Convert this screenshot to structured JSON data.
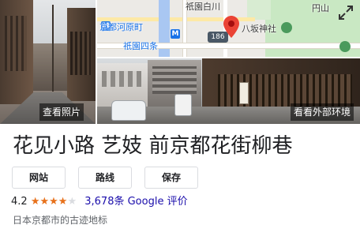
{
  "place": {
    "title": "花见小路 艺妓 前京都花街柳巷",
    "description": "日本京都市的古迹地标"
  },
  "photos": {
    "view_photos_label": "查看照片",
    "view_outside_label": "看看外部环境"
  },
  "map": {
    "labels": {
      "gion_shirakawa": "祇園白川",
      "maruyama": "円山",
      "kyoto_kawaramachi": "京都河原町",
      "yasaka_shrine": "八坂神社",
      "gion_shijo": "祇園四条",
      "route_number": "186"
    },
    "metro_glyph": "M",
    "expand_icon": "expand-icon"
  },
  "actions": {
    "website_label": "网站",
    "directions_label": "路线",
    "save_label": "保存"
  },
  "rating": {
    "score": "4.2",
    "stars_filled": "★★★★",
    "stars_empty": "★",
    "review_text": "3,678条 Google 评价"
  },
  "colors": {
    "star": "#e7711b",
    "link": "#1a0dab",
    "pin": "#ea4335",
    "metro": "#1a73e8"
  }
}
